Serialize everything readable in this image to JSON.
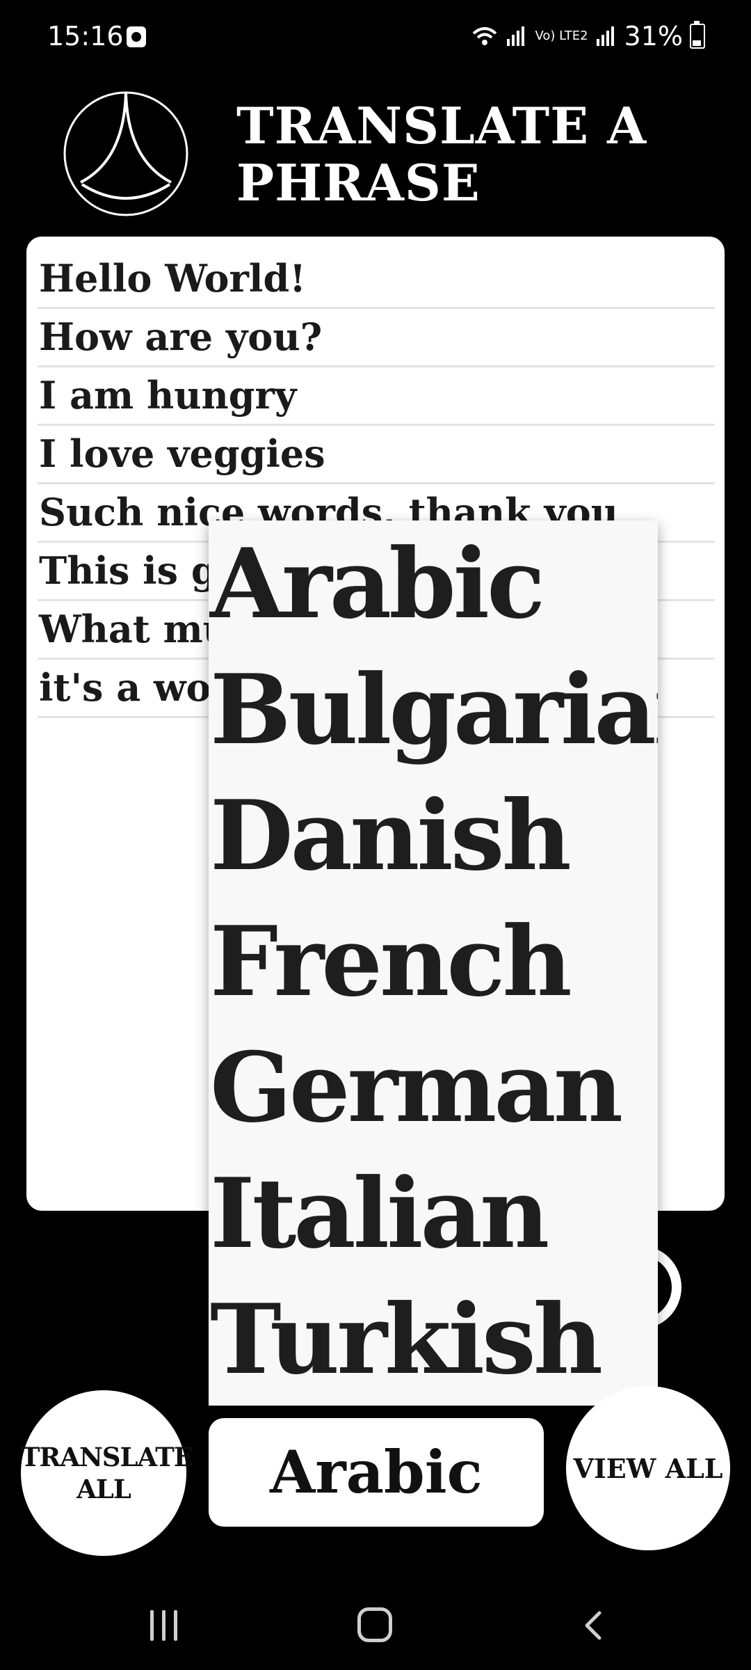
{
  "status_bar": {
    "time": "15:16",
    "network_label": "Vo) LTE2",
    "battery": "31%"
  },
  "header": {
    "title": "TRANSLATE A PHRASE"
  },
  "phrases": [
    "Hello World!",
    "How are you?",
    "I am hungry",
    "I love veggies",
    "Such nice words, thank you",
    "This is g",
    "What mu",
    "it's a wor"
  ],
  "dropdown": {
    "options": [
      "Arabic",
      "Bulgarian",
      "Danish",
      "French",
      "German",
      "Italian",
      "Turkish"
    ]
  },
  "controls": {
    "translate_all_line1": "TRANSLATE",
    "translate_all_line2": "ALL",
    "selected_language": "Arabic",
    "view_all_label": "VIEW ALL"
  },
  "colors": {
    "background": "#000000",
    "card": "#ffffff",
    "text": "#1a1a1a"
  }
}
